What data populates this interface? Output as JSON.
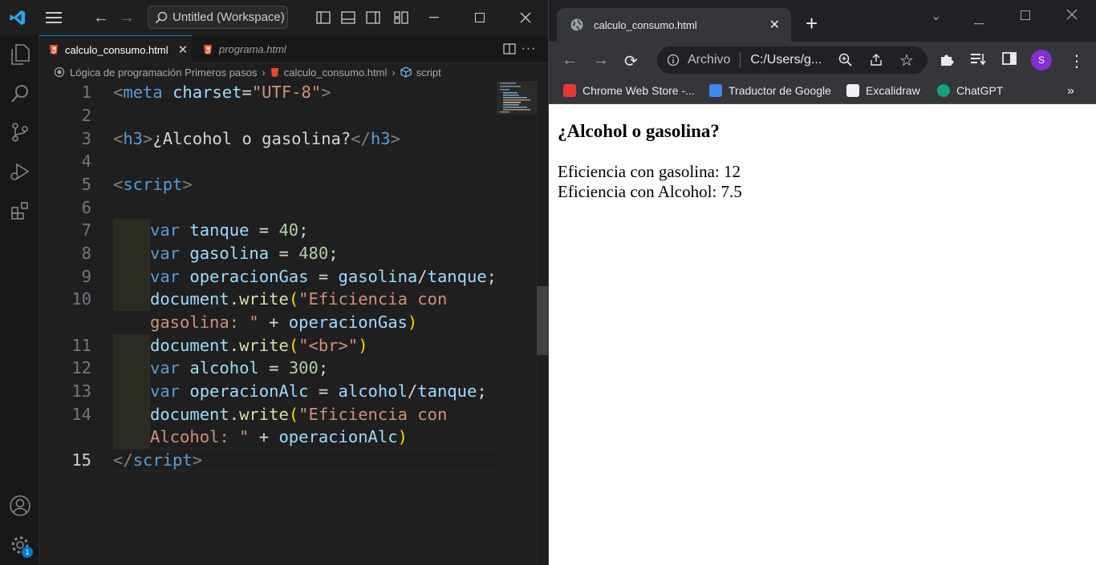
{
  "vscode": {
    "command_center": "Untitled (Workspace)",
    "tabs": [
      {
        "label": "calculo_consumo.html",
        "active": true
      },
      {
        "label": "programa.html",
        "active": false
      }
    ],
    "breadcrumb": [
      "Lógica de programación Primeros pasos",
      "calculo_consumo.html",
      "script"
    ],
    "settings_badge": "1",
    "line_numbers": [
      "1",
      "2",
      "3",
      "4",
      "5",
      "6",
      "7",
      "8",
      "9",
      "10",
      "11",
      "12",
      "13",
      "14",
      "15"
    ],
    "code": {
      "l1": [
        "<",
        "meta",
        " ",
        "charset",
        "=",
        "\"UTF-8\"",
        ">"
      ],
      "l3": [
        "<",
        "h3",
        ">",
        "¿Alcohol o gasolina?",
        "</",
        "h3",
        ">"
      ],
      "l5": [
        "<",
        "script",
        ">"
      ],
      "l7": [
        "var",
        " ",
        "tanque",
        " = ",
        "40",
        ";"
      ],
      "l8": [
        "var",
        " ",
        "gasolina",
        " = ",
        "480",
        ";"
      ],
      "l9": [
        "var",
        " ",
        "operacionGas",
        " = ",
        "gasolina",
        "/",
        "tanque",
        ";"
      ],
      "l10a": [
        "document",
        ".",
        "write",
        "(",
        "\"Eficiencia con"
      ],
      "l10b": [
        "gasolina: \"",
        " + ",
        "operacionGas",
        ")"
      ],
      "l11": [
        "document",
        ".",
        "write",
        "(",
        "\"<br>\"",
        ")"
      ],
      "l12": [
        "var",
        " ",
        "alcohol",
        " = ",
        "300",
        ";"
      ],
      "l13": [
        "var",
        " ",
        "operacionAlc",
        " = ",
        "alcohol",
        "/",
        "tanque",
        ";"
      ],
      "l14a": [
        "document",
        ".",
        "write",
        "(",
        "\"Eficiencia con"
      ],
      "l14b": [
        "Alcohol: \"",
        " + ",
        "operacionAlc",
        ")"
      ],
      "l15": [
        "</",
        "script",
        ">"
      ]
    }
  },
  "chrome": {
    "tab_title": "calculo_consumo.html",
    "omnibox_label": "Archivo",
    "omnibox_url": "C:/Users/g...",
    "avatar_letter": "S",
    "bookmarks": [
      "Chrome Web Store -...",
      "Traductor de Google",
      "Excalidraw",
      "ChatGPT"
    ],
    "bookmark_colors": [
      "#e53935",
      "#4285f4",
      "#f1f3f4",
      "#10a37f"
    ],
    "page": {
      "heading": "¿Alcohol o gasolina?",
      "line1": "Eficiencia con gasolina: 12",
      "line2": "Eficiencia con Alcohol: 7.5"
    }
  },
  "colors": {
    "accent": "#0078d4",
    "avatar": "#8430ce"
  }
}
